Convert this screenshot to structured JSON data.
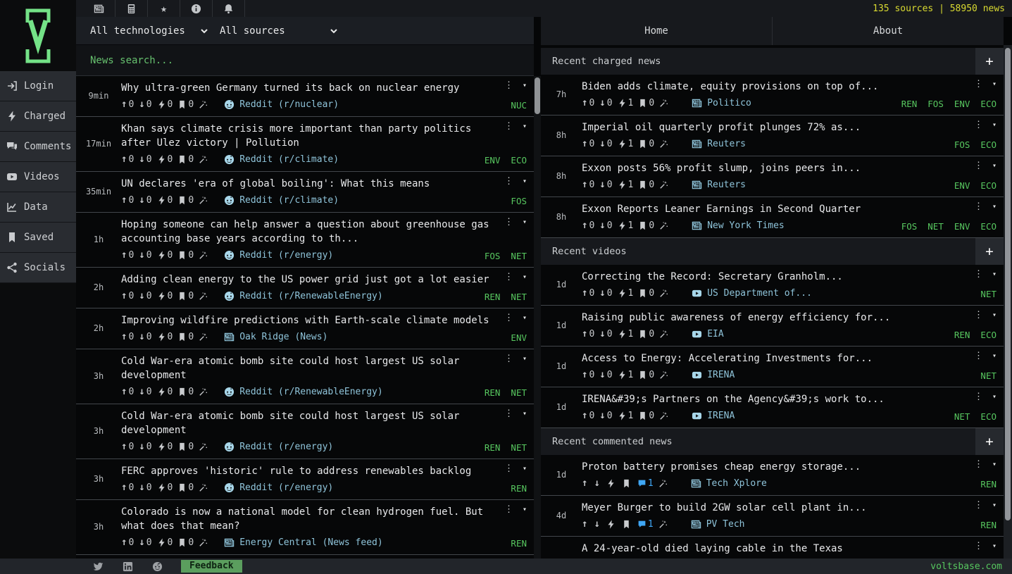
{
  "icons": {
    "up_arrow": "↑",
    "down_arrow": "↓",
    "kebab": "⋮",
    "caret": "▾",
    "star": "★"
  },
  "header": {
    "stats": "135 sources | 58950 news"
  },
  "topbar_icons": [
    "newspaper-icon",
    "calculator-icon",
    "star-icon",
    "info-icon",
    "bell-icon"
  ],
  "sidebar": {
    "items": [
      {
        "label": "Login",
        "icon": "login-icon"
      },
      {
        "label": "Charged",
        "icon": "lightning-icon"
      },
      {
        "label": "Comments",
        "icon": "comments-icon"
      },
      {
        "label": "Videos",
        "icon": "video-icon"
      },
      {
        "label": "Data",
        "icon": "chart-icon"
      },
      {
        "label": "Saved",
        "icon": "bookmark-icon"
      },
      {
        "label": "Socials",
        "icon": "share-icon"
      }
    ]
  },
  "filters": {
    "technologies_label": "All technologies",
    "sources_label": "All sources"
  },
  "search": {
    "placeholder": "News search..."
  },
  "tabs": [
    {
      "label": "Home"
    },
    {
      "label": "About"
    }
  ],
  "left_list": {
    "items": [
      {
        "time": "9min",
        "title": "Why ultra-green Germany turned its back on nuclear energy",
        "up": "0",
        "down": "0",
        "bolt": "0",
        "saved": "0",
        "comments": null,
        "source": "Reddit (r/nuclear)",
        "source_icon": "reddit-icon",
        "tags": [
          "NUC"
        ]
      },
      {
        "time": "17min",
        "title": "Khan says climate crisis more important than party politics after Ulez victory | Pollution",
        "up": "0",
        "down": "0",
        "bolt": "0",
        "saved": "0",
        "comments": null,
        "source": "Reddit (r/climate)",
        "source_icon": "reddit-icon",
        "tags": [
          "ENV",
          "ECO"
        ]
      },
      {
        "time": "35min",
        "title": "UN declares 'era of global boiling': What this means",
        "up": "0",
        "down": "0",
        "bolt": "0",
        "saved": "0",
        "comments": null,
        "source": "Reddit (r/climate)",
        "source_icon": "reddit-icon",
        "tags": [
          "FOS"
        ]
      },
      {
        "time": "1h",
        "title": "Hoping someone can help answer a question about greenhouse gas accounting base years according to th...",
        "up": "0",
        "down": "0",
        "bolt": "0",
        "saved": "0",
        "comments": null,
        "source": "Reddit (r/energy)",
        "source_icon": "reddit-icon",
        "tags": [
          "FOS",
          "NET"
        ]
      },
      {
        "time": "2h",
        "title": "Adding clean energy to the US power grid just got a lot easier",
        "up": "0",
        "down": "0",
        "bolt": "0",
        "saved": "0",
        "comments": null,
        "source": "Reddit (r/RenewableEnergy)",
        "source_icon": "reddit-icon",
        "tags": [
          "REN",
          "NET"
        ]
      },
      {
        "time": "2h",
        "title": "Improving wildfire predictions with Earth-scale climate models",
        "up": "0",
        "down": "0",
        "bolt": "0",
        "saved": "0",
        "comments": null,
        "source": "Oak Ridge (News)",
        "source_icon": "news-icon",
        "tags": [
          "ENV"
        ]
      },
      {
        "time": "3h",
        "title": "Cold War-era atomic bomb site could host largest US solar development",
        "up": "0",
        "down": "0",
        "bolt": "0",
        "saved": "0",
        "comments": null,
        "source": "Reddit (r/RenewableEnergy)",
        "source_icon": "reddit-icon",
        "tags": [
          "REN",
          "NET"
        ]
      },
      {
        "time": "3h",
        "title": "Cold War-era atomic bomb site could host largest US solar development",
        "up": "0",
        "down": "0",
        "bolt": "0",
        "saved": "0",
        "comments": null,
        "source": "Reddit (r/energy)",
        "source_icon": "reddit-icon",
        "tags": [
          "REN",
          "NET"
        ]
      },
      {
        "time": "3h",
        "title": "FERC approves 'historic' rule to address renewables backlog",
        "up": "0",
        "down": "0",
        "bolt": "0",
        "saved": "0",
        "comments": null,
        "source": "Reddit (r/energy)",
        "source_icon": "reddit-icon",
        "tags": [
          "REN"
        ]
      },
      {
        "time": "3h",
        "title": "Colorado is now a national model for clean hydrogen fuel. But what does that mean?",
        "up": "0",
        "down": "0",
        "bolt": "0",
        "saved": "0",
        "comments": null,
        "source": "Energy Central (News feed)",
        "source_icon": "news-icon",
        "tags": [
          "REN"
        ]
      }
    ]
  },
  "right_panel": {
    "plus_label": "+",
    "sections": [
      {
        "title": "Recent charged news",
        "items": [
          {
            "time": "7h",
            "title": "Biden adds climate, equity provisions on top of...",
            "up": "0",
            "down": "0",
            "bolt": "1",
            "saved": "0",
            "comments": null,
            "source": "Politico",
            "source_icon": "news-icon",
            "tags": [
              "REN",
              "FOS",
              "ENV",
              "ECO"
            ]
          },
          {
            "time": "8h",
            "title": "Imperial oil quarterly profit plunges 72% as...",
            "up": "0",
            "down": "0",
            "bolt": "1",
            "saved": "0",
            "comments": null,
            "source": "Reuters",
            "source_icon": "news-icon",
            "tags": [
              "FOS",
              "ECO"
            ]
          },
          {
            "time": "8h",
            "title": "Exxon posts 56% profit slump, joins peers in...",
            "up": "0",
            "down": "0",
            "bolt": "1",
            "saved": "0",
            "comments": null,
            "source": "Reuters",
            "source_icon": "news-icon",
            "tags": [
              "ENV",
              "ECO"
            ]
          },
          {
            "time": "8h",
            "title": "Exxon Reports Leaner Earnings in Second Quarter",
            "up": "0",
            "down": "0",
            "bolt": "1",
            "saved": "0",
            "comments": null,
            "source": "New York Times",
            "source_icon": "news-icon",
            "tags": [
              "FOS",
              "NET",
              "ENV",
              "ECO"
            ]
          }
        ]
      },
      {
        "title": "Recent videos",
        "items": [
          {
            "time": "1d",
            "title": "Correcting the Record: Secretary Granholm...",
            "up": "0",
            "down": "0",
            "bolt": "1",
            "saved": "0",
            "comments": null,
            "source": "US Department of...",
            "source_icon": "youtube-icon",
            "tags": [
              "NET"
            ]
          },
          {
            "time": "1d",
            "title": "Raising public awareness of energy efficiency for...",
            "up": "0",
            "down": "0",
            "bolt": "1",
            "saved": "0",
            "comments": null,
            "source": "EIA",
            "source_icon": "youtube-icon",
            "tags": [
              "REN",
              "ECO"
            ]
          },
          {
            "time": "1d",
            "title": "Access to Energy: Accelerating Investments for...",
            "up": "0",
            "down": "0",
            "bolt": "1",
            "saved": "0",
            "comments": null,
            "source": "IRENA",
            "source_icon": "youtube-icon",
            "tags": [
              "NET"
            ]
          },
          {
            "time": "1d",
            "title": "IRENA&#39;s Partners on the Agency&#39;s work to...",
            "up": "0",
            "down": "0",
            "bolt": "1",
            "saved": "0",
            "comments": null,
            "source": "IRENA",
            "source_icon": "youtube-icon",
            "tags": [
              "NET",
              "ECO"
            ]
          }
        ]
      },
      {
        "title": "Recent commented news",
        "items": [
          {
            "time": "1d",
            "title": "Proton battery promises cheap energy storage...",
            "up": "",
            "down": "",
            "bolt": "",
            "saved": "",
            "comments": "1",
            "source": "Tech Xplore",
            "source_icon": "news-icon",
            "tags": [
              "REN"
            ]
          },
          {
            "time": "4d",
            "title": "Meyer Burger to build 2GW solar cell plant in...",
            "up": "",
            "down": "",
            "bolt": "",
            "saved": "",
            "comments": "1",
            "source": "PV Tech",
            "source_icon": "news-icon",
            "tags": [
              "REN"
            ]
          },
          {
            "time": "",
            "title": "A 24-year-old died laying cable in the Texas",
            "up": null,
            "down": null,
            "bolt": null,
            "saved": null,
            "comments": null,
            "source": null,
            "source_icon": "none",
            "tags": [],
            "partial": true
          }
        ]
      }
    ]
  },
  "footer": {
    "feedback_label": "Feedback",
    "site_link": "voltsbase.com"
  }
}
